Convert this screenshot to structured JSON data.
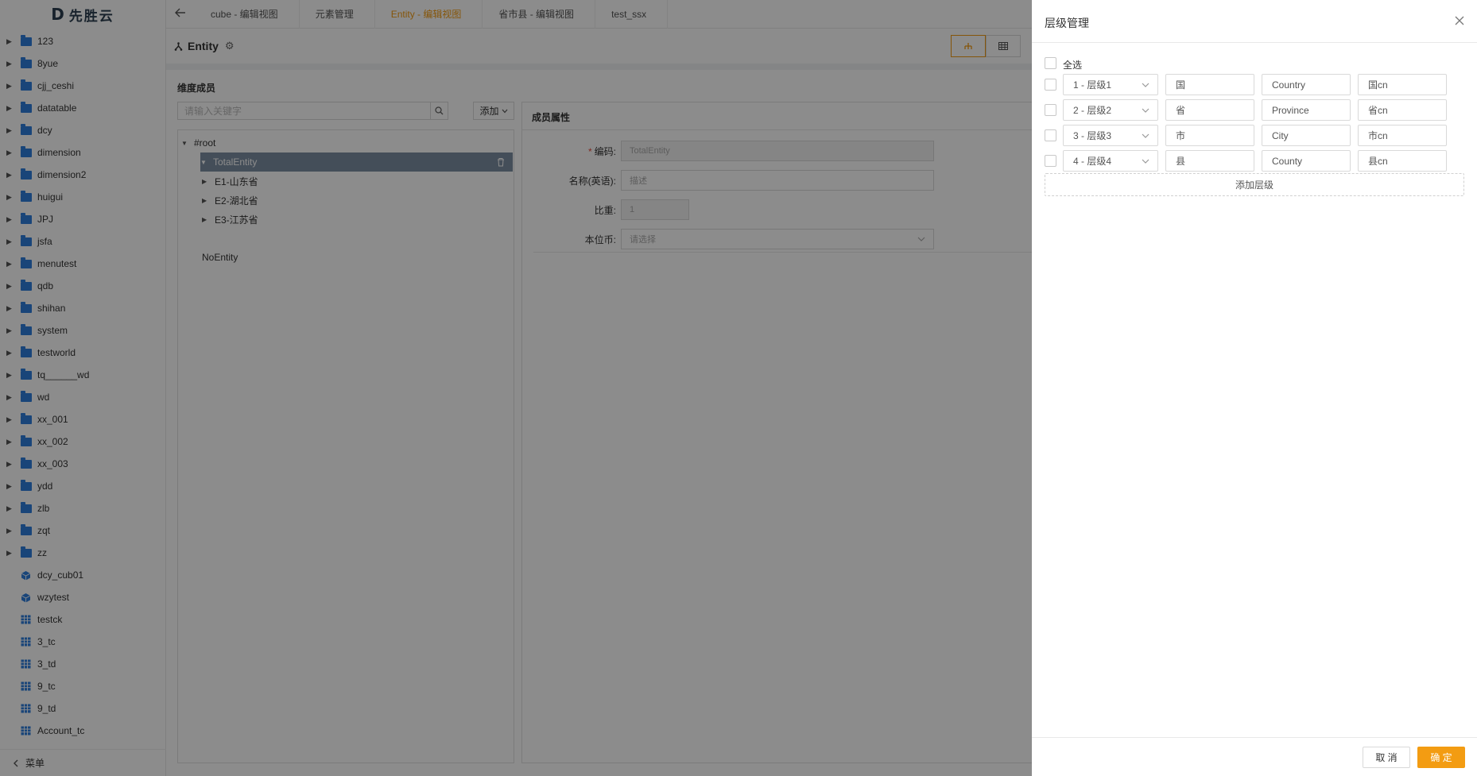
{
  "app": {
    "logo_text": "先胜云",
    "logo_mark": "D"
  },
  "sidebar": {
    "items": [
      {
        "label": "123",
        "icon": "folder-icon",
        "expandable": true
      },
      {
        "label": "8yue",
        "icon": "folder-icon",
        "expandable": true
      },
      {
        "label": "cjj_ceshi",
        "icon": "folder-icon",
        "expandable": true
      },
      {
        "label": "datatable",
        "icon": "folder-icon",
        "expandable": true
      },
      {
        "label": "dcy",
        "icon": "folder-icon",
        "expandable": true
      },
      {
        "label": "dimension",
        "icon": "folder-icon",
        "expandable": true
      },
      {
        "label": "dimension2",
        "icon": "folder-icon",
        "expandable": true
      },
      {
        "label": "huigui",
        "icon": "folder-icon",
        "expandable": true
      },
      {
        "label": "JPJ",
        "icon": "folder-icon",
        "expandable": true
      },
      {
        "label": "jsfa",
        "icon": "folder-icon",
        "expandable": true
      },
      {
        "label": "menutest",
        "icon": "folder-icon",
        "expandable": true
      },
      {
        "label": "qdb",
        "icon": "folder-icon",
        "expandable": true
      },
      {
        "label": "shihan",
        "icon": "folder-icon",
        "expandable": true
      },
      {
        "label": "system",
        "icon": "folder-icon",
        "expandable": true
      },
      {
        "label": "testworld",
        "icon": "folder-icon",
        "expandable": true
      },
      {
        "label": "tq______wd",
        "icon": "folder-icon",
        "expandable": true
      },
      {
        "label": "wd",
        "icon": "folder-icon",
        "expandable": true
      },
      {
        "label": "xx_001",
        "icon": "folder-icon",
        "expandable": true
      },
      {
        "label": "xx_002",
        "icon": "folder-icon",
        "expandable": true
      },
      {
        "label": "xx_003",
        "icon": "folder-icon",
        "expandable": true
      },
      {
        "label": "ydd",
        "icon": "folder-icon",
        "expandable": true
      },
      {
        "label": "zlb",
        "icon": "folder-icon",
        "expandable": true
      },
      {
        "label": "zqt",
        "icon": "folder-icon",
        "expandable": true
      },
      {
        "label": "zz",
        "icon": "folder-icon",
        "expandable": true
      },
      {
        "label": "dcy_cub01",
        "icon": "cube-icon",
        "expandable": false
      },
      {
        "label": "wzytest",
        "icon": "cube-icon",
        "expandable": false
      },
      {
        "label": "testck",
        "icon": "table-icon",
        "expandable": false
      },
      {
        "label": "3_tc",
        "icon": "table-icon",
        "expandable": false
      },
      {
        "label": "3_td",
        "icon": "table-icon",
        "expandable": false
      },
      {
        "label": "9_tc",
        "icon": "table-icon",
        "expandable": false
      },
      {
        "label": "9_td",
        "icon": "table-icon",
        "expandable": false
      },
      {
        "label": "Account_tc",
        "icon": "table-icon",
        "expandable": false
      }
    ],
    "footer_label": "菜单"
  },
  "tabs": [
    {
      "label": "cube - 编辑视图",
      "active": false
    },
    {
      "label": "元素管理",
      "active": false
    },
    {
      "label": "Entity - 编辑视图",
      "active": true
    },
    {
      "label": "省市县 - 编辑视图",
      "active": false
    },
    {
      "label": "test_ssx",
      "active": false
    }
  ],
  "entity": {
    "title": "Entity"
  },
  "members": {
    "section_title": "维度成员",
    "search_placeholder": "请输入关键字",
    "add_label": "添加",
    "tree": {
      "root": "#root",
      "selected": "TotalEntity",
      "children": [
        "E1-山东省",
        "E2-湖北省",
        "E3-江苏省"
      ],
      "other": "NoEntity"
    }
  },
  "attributes": {
    "title": "成员属性",
    "code_label": "编码:",
    "code_value": "TotalEntity",
    "name_label": "名称(英语):",
    "name_placeholder": "描述",
    "weight_label": "比重:",
    "weight_value": "1",
    "currency_label": "本位币:",
    "currency_placeholder": "请选择"
  },
  "drawer": {
    "title": "层级管理",
    "select_all": "全选",
    "levels": [
      {
        "level": "1 - 层级1",
        "name": "国",
        "en": "Country",
        "cn": "国cn"
      },
      {
        "level": "2 - 层级2",
        "name": "省",
        "en": "Province",
        "cn": "省cn"
      },
      {
        "level": "3 - 层级3",
        "name": "市",
        "en": "City",
        "cn": "市cn"
      },
      {
        "level": "4 - 层级4",
        "name": "县",
        "en": "County",
        "cn": "县cn"
      }
    ],
    "add_level": "添加层级",
    "cancel": "取 消",
    "ok": "确 定"
  },
  "colors": {
    "accent": "#f39c12",
    "folder": "#2f7fdc",
    "selected_row": "#7d8ea3"
  }
}
